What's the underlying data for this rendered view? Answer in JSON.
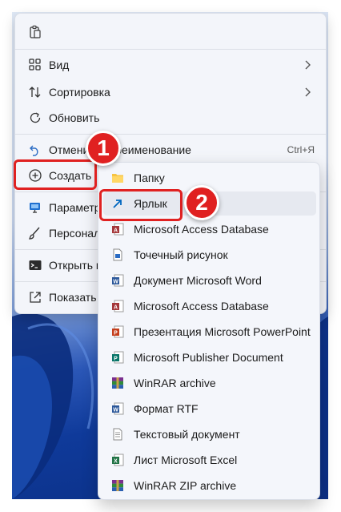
{
  "menu": {
    "items": [
      {
        "label": "Вид",
        "icon": "grid-icon",
        "submenu": true
      },
      {
        "label": "Сортировка",
        "icon": "sort-icon",
        "submenu": true
      },
      {
        "label": "Обновить",
        "icon": "refresh-icon"
      },
      {
        "label": "Отменить переименование",
        "icon": "undo-icon",
        "shortcut": "Ctrl+Я"
      },
      {
        "label": "Создать",
        "icon": "plus-circle-icon"
      },
      {
        "label": "Параметры экрана",
        "icon": "display-settings-icon"
      },
      {
        "label": "Персонализация",
        "icon": "brush-icon"
      },
      {
        "label": "Открыть в Терминале",
        "icon": "terminal-icon"
      },
      {
        "label": "Показать дополнительные параметры",
        "icon": "open-external-icon"
      }
    ]
  },
  "submenu": {
    "items": [
      {
        "label": "Папку",
        "icon": "folder-icon"
      },
      {
        "label": "Ярлык",
        "icon": "shortcut-arrow-icon"
      },
      {
        "label": "Microsoft Access Database",
        "icon": "access-icon"
      },
      {
        "label": "Точечный рисунок",
        "icon": "bitmap-icon"
      },
      {
        "label": "Документ Microsoft Word",
        "icon": "word-icon"
      },
      {
        "label": "Microsoft Access Database",
        "icon": "access-icon"
      },
      {
        "label": "Презентация Microsoft PowerPoint",
        "icon": "powerpoint-icon"
      },
      {
        "label": "Microsoft Publisher Document",
        "icon": "publisher-icon"
      },
      {
        "label": "WinRAR archive",
        "icon": "winrar-icon"
      },
      {
        "label": "Формат RTF",
        "icon": "rtf-icon"
      },
      {
        "label": "Текстовый документ",
        "icon": "text-document-icon"
      },
      {
        "label": "Лист Microsoft Excel",
        "icon": "excel-icon"
      },
      {
        "label": "WinRAR ZIP archive",
        "icon": "winrar-zip-icon"
      }
    ]
  },
  "annotations": {
    "step1": "1",
    "step2": "2"
  },
  "colors": {
    "highlight": "#e02121",
    "accent": "#0067c0"
  }
}
